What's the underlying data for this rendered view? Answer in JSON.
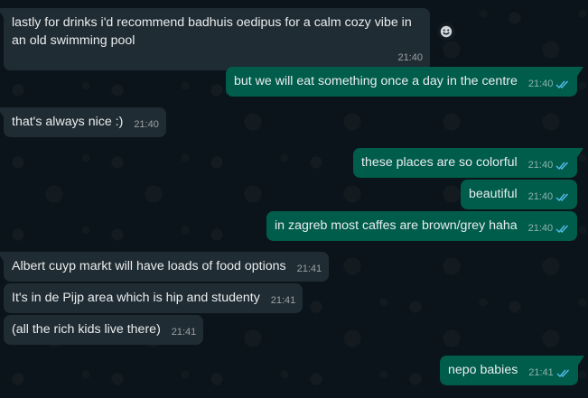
{
  "messages": [
    {
      "id": "m1",
      "direction": "incoming",
      "text": "lastly for drinks i'd recommend badhuis oedipus for a calm cozy vibe in an old swimming pool",
      "time": "21:40"
    },
    {
      "id": "m2",
      "direction": "outgoing",
      "text": "but we will eat something once a day in the centre",
      "time": "21:40",
      "read": true
    },
    {
      "id": "m3",
      "direction": "incoming",
      "text": "that's always nice :)",
      "time": "21:40"
    },
    {
      "id": "m4",
      "direction": "outgoing",
      "text": "these places are so colorful",
      "time": "21:40",
      "read": true
    },
    {
      "id": "m5",
      "direction": "outgoing",
      "text": "beautiful",
      "time": "21:40",
      "read": true
    },
    {
      "id": "m6",
      "direction": "outgoing",
      "text": "in zagreb most caffes are brown/grey haha",
      "time": "21:40",
      "read": true
    },
    {
      "id": "m7",
      "direction": "incoming",
      "text": "Albert cuyp markt will have loads of food options",
      "time": "21:41"
    },
    {
      "id": "m8",
      "direction": "incoming",
      "text": "It's in de Pijp area which is hip and studenty",
      "time": "21:41"
    },
    {
      "id": "m9",
      "direction": "incoming",
      "text": "(all the rich kids live there)",
      "time": "21:41"
    },
    {
      "id": "m10",
      "direction": "outgoing",
      "text": "nepo babies",
      "time": "21:41",
      "read": true
    }
  ],
  "colors": {
    "background": "#0b141a",
    "incoming_bubble": "#202c33",
    "outgoing_bubble": "#005c4b",
    "read_ticks": "#53bdeb"
  },
  "icons": {
    "reaction": "emoji-smile-icon",
    "read_receipt": "double-check-icon"
  }
}
